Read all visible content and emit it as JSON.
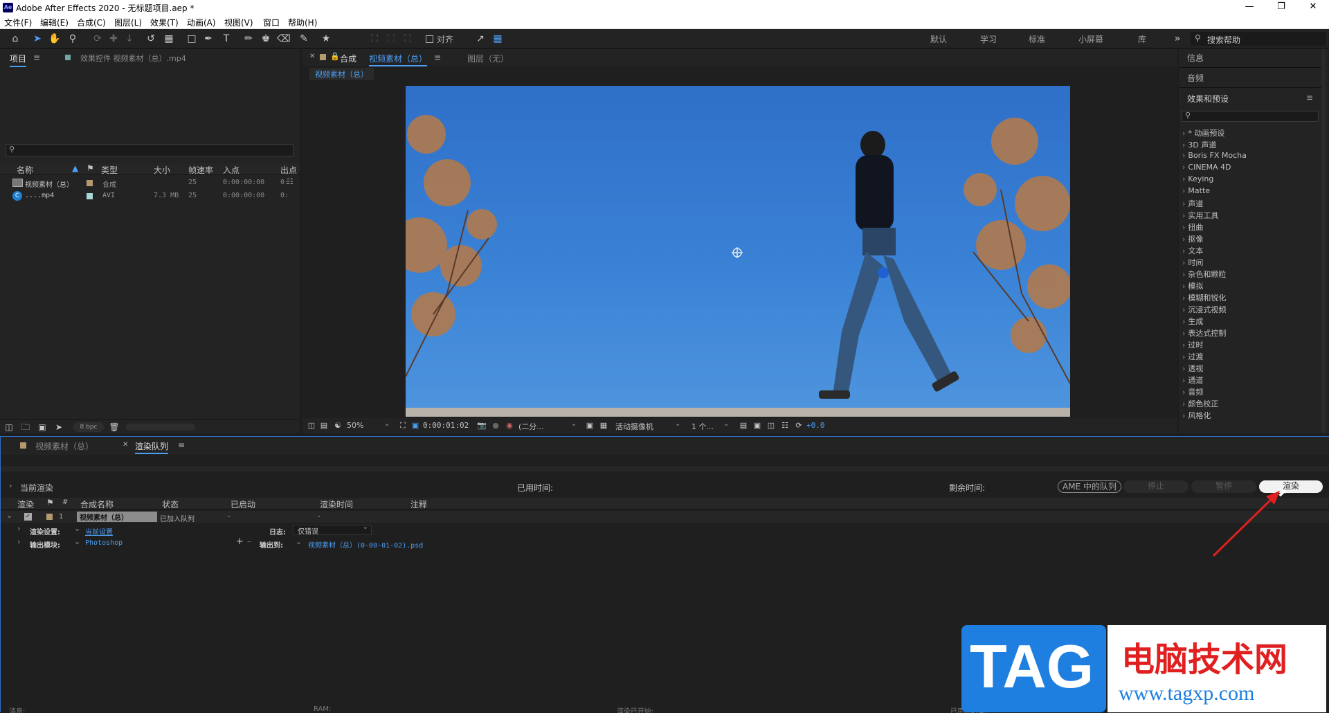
{
  "app": {
    "window_title": "Adobe After Effects 2020 - 无标题项目.aep *",
    "logo_text": "Ae"
  },
  "menu": [
    "文件(F)",
    "编辑(E)",
    "合成(C)",
    "图层(L)",
    "效果(T)",
    "动画(A)",
    "视图(V)",
    "窗口",
    "帮助(H)"
  ],
  "toolbar": {
    "align_label": "对齐",
    "workspaces": [
      "默认",
      "学习",
      "标准",
      "小屏幕",
      "库"
    ],
    "search_placeholder": "搜索帮助"
  },
  "project_panel": {
    "tab_label": "项目",
    "effects_control_label": "效果控件 视频素材（总）.mp4",
    "columns": [
      "名称",
      "类型",
      "大小",
      "帧速率",
      "入点",
      "出点"
    ],
    "rows": [
      {
        "name": "视频素材（总）",
        "type": "合成",
        "size": "",
        "fps": "25",
        "in": "0:00:00:00",
        "out": "0:"
      },
      {
        "name": "....mp4",
        "type": "AVI",
        "size": "7.3 MB",
        "fps": "25",
        "in": "0:00:00:00",
        "out": "0:"
      }
    ],
    "bpc": "8 bpc"
  },
  "composition_panel": {
    "tab_prefix": "合成",
    "tab_name": "视频素材（总）",
    "layer_tab": "图层（无）",
    "breadcrumb": "视频素材（总）",
    "zoom": "50%",
    "timecode": "0:00:01:02",
    "resolution": "(二分...",
    "camera": "活动摄像机",
    "views": "1 个...",
    "exposure": "+0.0"
  },
  "right_panel": {
    "info": "信息",
    "audio": "音频",
    "effects_title": "效果和预设",
    "effects": [
      "* 动画预设",
      "3D 声道",
      "Boris FX Mocha",
      "CINEMA 4D",
      "Keying",
      "Matte",
      "声道",
      "实用工具",
      "扭曲",
      "抠像",
      "文本",
      "时间",
      "杂色和颗粒",
      "模拟",
      "模糊和锐化",
      "沉浸式视频",
      "生成",
      "表达式控制",
      "过时",
      "过渡",
      "透视",
      "通道",
      "音频",
      "颜色校正",
      "风格化"
    ]
  },
  "bottom_tabs": {
    "tab1": "视频素材（总）",
    "tab2": "渲染队列"
  },
  "render_queue": {
    "current_render": "当前渲染",
    "elapsed_label": "已用时间:",
    "remaining_label": "剩余时间:",
    "ame_button": "AME 中的队列",
    "stop_button": "停止",
    "pause_button": "暂停",
    "render_button": "渲染",
    "columns": [
      "渲染",
      "#",
      "合成名称",
      "状态",
      "已启动",
      "渲染时间",
      "注释"
    ],
    "item": {
      "index": "1",
      "comp_name": "视频素材（总）",
      "status": "已加入队列",
      "started": "-",
      "render_time": "-"
    },
    "render_settings_label": "渲染设置:",
    "render_settings_value": "当前设置",
    "log_label": "日志:",
    "log_value": "仅错误",
    "output_module_label": "输出模块:",
    "output_module_value": "Photoshop",
    "output_to_label": "输出到:",
    "output_to_value": "视频素材（总）(0-00-01-02).psd",
    "footer": [
      "消息:",
      "RAM:",
      "渲染已开始:",
      "已用总时间:"
    ]
  },
  "watermark": {
    "tag": "TAG",
    "site_name": "电脑技术网",
    "url": "www.tagxp.com"
  }
}
